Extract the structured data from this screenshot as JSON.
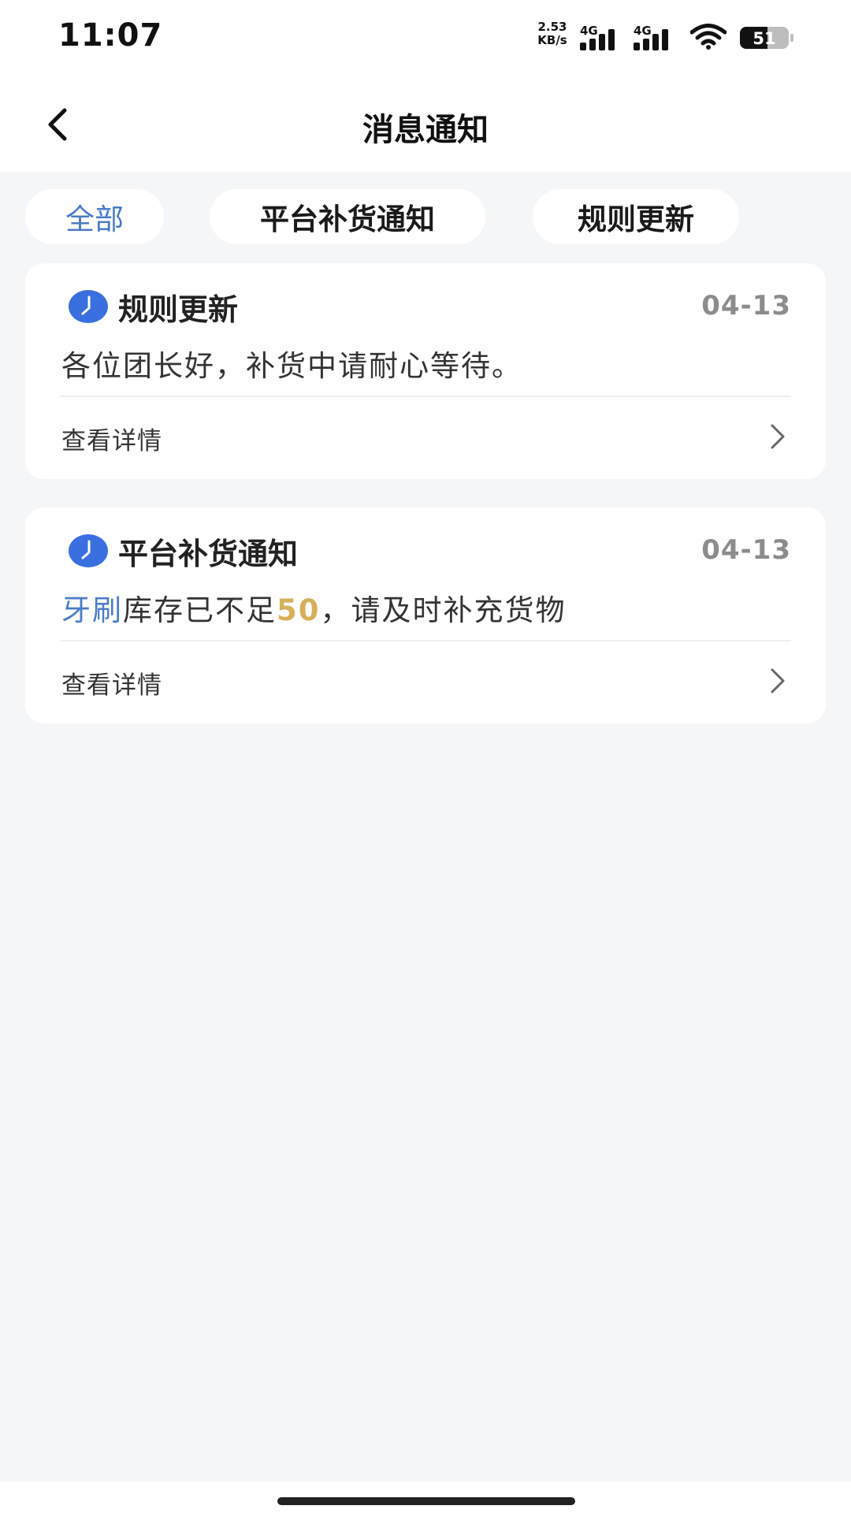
{
  "status_bar": {
    "time": "11:07",
    "net_speed_value": "2.53",
    "net_speed_unit": "KB/s",
    "sim1_type": "4G",
    "sim2_type": "4G",
    "battery": "51"
  },
  "header": {
    "title": "消息通知",
    "back_icon": "chevron-left-icon"
  },
  "tabs": [
    {
      "label": "全部",
      "active": true
    },
    {
      "label": "平台补货通知",
      "active": false
    },
    {
      "label": "规则更新",
      "active": false
    }
  ],
  "colors": {
    "accent": "#4a7cc9",
    "highlight": "#d7b05a",
    "icon_blue": "#3a6fe0",
    "background": "#f5f6f8"
  },
  "notifications": [
    {
      "icon": "clock-icon",
      "title": "规则更新",
      "date": "04-13",
      "body": "各位团长好，补货中请耐心等待。",
      "detail_label": "查看详情"
    },
    {
      "icon": "clock-icon",
      "title": "平台补货通知",
      "date": "04-13",
      "body_product": "牙刷",
      "body_mid": "库存已不足",
      "body_count": "50",
      "body_end": "，请及时补充货物",
      "detail_label": "查看详情"
    }
  ]
}
